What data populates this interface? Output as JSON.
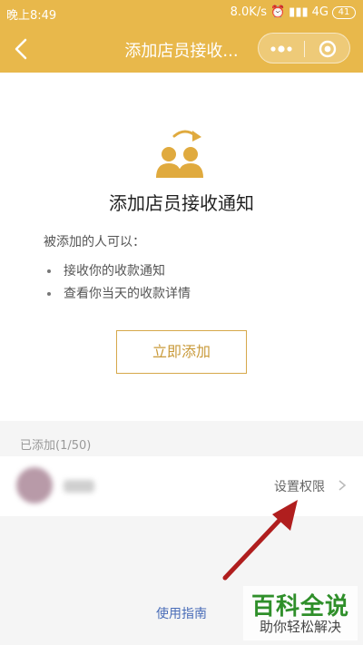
{
  "status_bar": {
    "time": "晚上8:49",
    "speed": "8.0K/s",
    "network": "4G",
    "battery": "41"
  },
  "nav": {
    "title": "添加店员接收..."
  },
  "hero": {
    "title": "添加店员接收通知"
  },
  "description": {
    "lead": "被添加的人可以：",
    "items": [
      "接收你的收款通知",
      "查看你当天的收款详情"
    ]
  },
  "add_button": {
    "label": "立即添加"
  },
  "added": {
    "label": "已添加(1/50)",
    "members": [
      {
        "permission_label": "设置权限"
      }
    ]
  },
  "guide": {
    "label": "使用指南"
  },
  "watermark": {
    "title": "百科全说",
    "subtitle": "助你轻松解决"
  },
  "colors": {
    "header": "#e8b84b",
    "accent": "#d6a84a",
    "link": "#4a6db8",
    "arrow": "#b01e1e"
  },
  "icons": [
    "back-arrow-icon",
    "more-dots-icon",
    "miniprogram-close-icon",
    "staff-transfer-icon",
    "chevron-right-icon",
    "annotation-arrow-icon"
  ]
}
